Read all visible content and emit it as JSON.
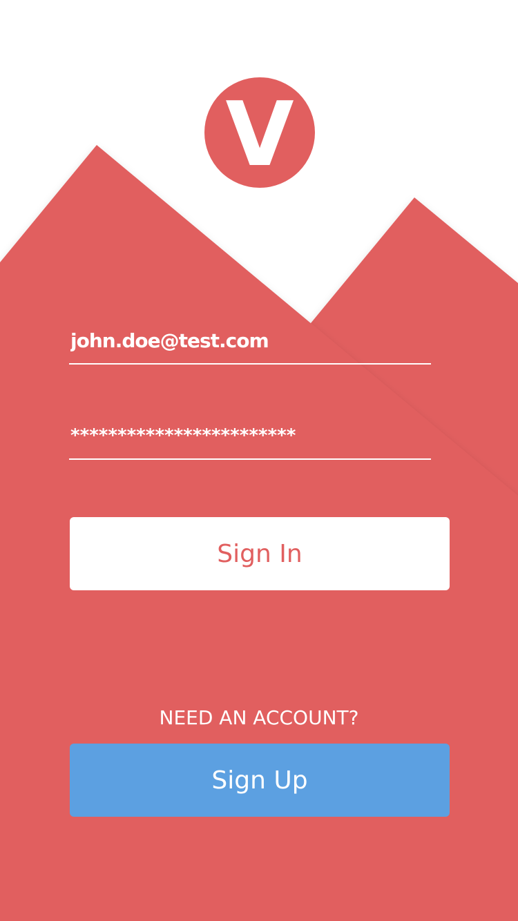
{
  "colors": {
    "brand_red": "#e15f5f",
    "accent_blue": "#5ca0e1",
    "background": "#ffffff"
  },
  "logo": {
    "letter": "V",
    "icon": "v-logo-icon"
  },
  "login_form": {
    "email_value": "john.doe@test.com",
    "password_value": "************************",
    "signin_label": "Sign In"
  },
  "signup": {
    "prompt": "NEED AN ACCOUNT?",
    "button_label": "Sign Up"
  }
}
